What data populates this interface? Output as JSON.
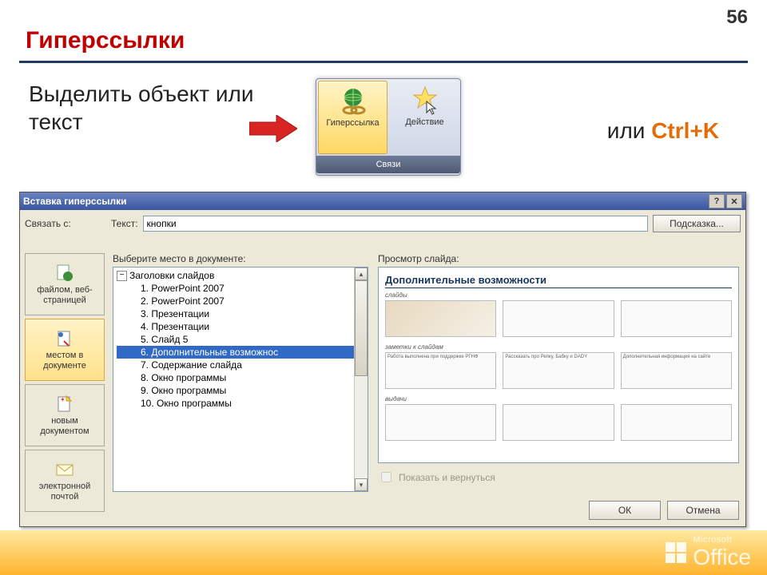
{
  "page_number": "56",
  "slide_title": "Гиперссылки",
  "step_text": "Выделить объект или текст",
  "ribbon": {
    "hyperlink_label": "Гиперссылка",
    "action_label": "Действие",
    "group_label": "Связи"
  },
  "shortcut": {
    "or": "или",
    "key": "Ctrl+K"
  },
  "dialog": {
    "title": "Вставка гиперссылки",
    "link_with_label": "Связать с:",
    "text_label": "Текст:",
    "text_value": "кнопки",
    "hint_button": "Подсказка...",
    "sidebar": [
      {
        "label": "файлом, веб-страницей"
      },
      {
        "label": "местом в документе"
      },
      {
        "label": "новым документом"
      },
      {
        "label": "электронной почтой"
      }
    ],
    "tree_label": "Выберите место в документе:",
    "tree_root": "Заголовки слайдов",
    "tree_items": [
      "1. PowerPoint 2007",
      "2. PowerPoint 2007",
      "3. Презентации",
      "4. Презентации",
      "5. Слайд 5",
      "6. Дополнительные возможнос",
      "7. Содержание слайда",
      "8. Окно программы",
      "9. Окно программы",
      "10. Окно программы"
    ],
    "tree_selected_index": 5,
    "preview_label": "Просмотр слайда:",
    "preview_title": "Дополнительные возможности",
    "preview_sections": [
      "слайды",
      "заметки к слайдам",
      "выдачи"
    ],
    "preview_notes": [
      "Работа выполнена при поддержке РГНФ",
      "Рассказать про Репку, Бабку и DADY",
      "Дополнительная информация на сайте"
    ],
    "show_return": "Показать и вернуться",
    "ok": "ОК",
    "cancel": "Отмена"
  },
  "footer": {
    "brand_small": "Microsoft",
    "brand_big": "Office"
  }
}
